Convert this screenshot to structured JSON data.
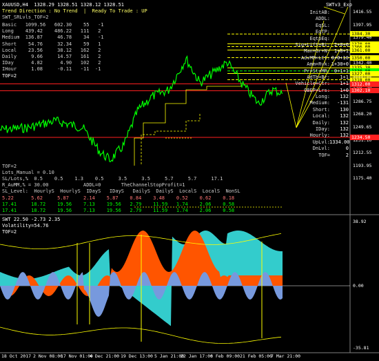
{
  "main": {
    "header_title": "XAUUSD,H4  1328.29 1328.51 1328.12 1328.51",
    "header_status": "Trend Direction : No Trend  |  Ready To Trade : UP",
    "header_sub": "SWT_SRLvls_TOF=2",
    "corner_label": "SWTv3_Exp",
    "left_table": [
      "Basic   1099.56   602.30    55   -1",
      "Long    439.42    486.22   111   2",
      "Medium  136.87     46.78    34   -1",
      "Short    54.76     32.34    59   1",
      "Local    23.56     38.12   162   2",
      "Daily     9.66     14.57   161   2",
      "IDay      4.82      4.90   102   2",
      "IHour     1.08     -0.11   -11  -1",
      "TOF=2"
    ],
    "right_labels": [
      "InitAB:",
      "ADDL:",
      "EqSL:",
      "EqTP:",
      "EqtpEq:",
      "Sig+Lift+Bi:",
      "Man+Gr+N:",
      "AdvMM+LCt:",
      "Amm+Rvk:",
      "Pr+St+MR:",
      "AdTb+Br:",
      "Vehicle+Ctr:",
      "OBEP+Lrs:",
      "Long:",
      "Medium:",
      "Short:",
      "Local:",
      "Daily:",
      "IDay:",
      "Hourly:",
      "UpLvl:",
      "DnLvl:",
      "TOF="
    ],
    "right_values": [
      "",
      "",
      "",
      "",
      "",
      "2+0+0",
      "1+0+1",
      "0+0+10",
      "1+30+0",
      "0+1+1",
      "1+1",
      "1+1",
      "1+0",
      "132",
      "-131",
      "130",
      "132",
      "132",
      "132",
      "132",
      "1334.00",
      "0",
      "2"
    ],
    "bottom_lines": [
      "TOF=2",
      "Lots_Manual = 0.10",
      "SL/Lots,%  0.5    0.5    1.3    0.5     3.5     3.5     5.7     5.7     17.1",
      "R_AuMM,% = 30.00            ADDL=0       TheChannelStopProfit=1",
      "SL_Level:  HourlyS  HourlyS  IDayS   IDayS   DailyS  DailyS  LocalS  LocalS  NonSL",
      "5.22      5.62     5.87     2.14    5.87    0.84    3.48    0.52    0.62    0.18",
      "17.41     18.72    19.56    7.13    19.56   2.79    11.59   1.74    2.06    0.58",
      "17.41     18.72    19.56    7.13    19.56   2.79    11.59   1.74    2.06    0.58"
    ],
    "price_axis": [
      "1416.55",
      "1397.95",
      "1379.40",
      "1360.85",
      "1342.40",
      "1323.85",
      "1305.30",
      "1286.75",
      "1268.20",
      "1249.65",
      "1231.10",
      "1212.55",
      "1193.95",
      "1175.40"
    ],
    "price_tags": [
      {
        "value": "1384.30",
        "color": "#ffff00"
      },
      {
        "value": "1370.00",
        "color": "#ffff00"
      },
      {
        "value": "1366.00",
        "color": "#ffff00"
      },
      {
        "value": "1361.00",
        "color": "#ffff00"
      },
      {
        "value": "1350.00",
        "color": "#ffff00"
      },
      {
        "value": "1335.30",
        "color": "#ffff00"
      },
      {
        "value": "1330.80",
        "color": "#00ff00"
      },
      {
        "value": "1327.00",
        "color": "#ffff00"
      },
      {
        "value": "1318.00",
        "color": "#ffff00"
      },
      {
        "value": "1312.00",
        "color": "#ff2020"
      },
      {
        "value": "1302.10",
        "color": "#ff2020"
      },
      {
        "value": "1234.50",
        "color": "#ff2020"
      }
    ]
  },
  "sub": {
    "title": "SWT 22.50 -2.73 2.35",
    "volatility": "Volatility=54.76",
    "tof": "TOF=2",
    "axis": [
      "38.92",
      "0.00",
      "-35.81"
    ]
  },
  "time_axis": [
    "18 Oct 2017",
    "2 Nov 08:00",
    "17 Nov 01:00",
    "4 Dec 21:00",
    "19 Dec 13:00",
    "5 Jan 21:00",
    "22 Jan 17:00",
    "6 Feb 09:00",
    "21 Feb 05:00",
    "7 Mar 21:00"
  ],
  "colors": {
    "background": "#000000",
    "price_line": "#00ff00",
    "level_yellow": "#ffff00",
    "level_red": "#ff2020",
    "histo_cyan": "#33cccc",
    "histo_orange": "#ff5500",
    "histo_blue": "#7799dd"
  }
}
